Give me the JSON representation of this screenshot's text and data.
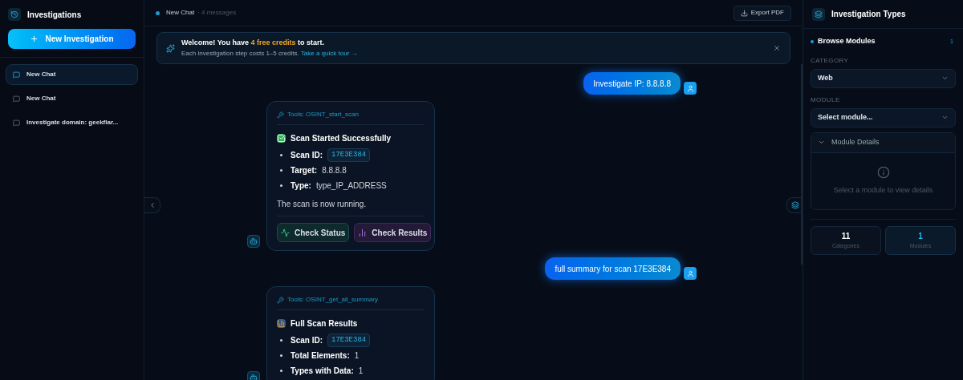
{
  "sidebar": {
    "title": "Investigations",
    "new_button": "New Investigation",
    "items": [
      {
        "label": "New Chat",
        "selected": true
      },
      {
        "label": "New Chat",
        "selected": false
      },
      {
        "label": "Investigate domain: geekflar...",
        "selected": false
      }
    ]
  },
  "chat": {
    "header": {
      "title": "New Chat",
      "meta": "· 4 messages"
    },
    "export_button": "Export PDF",
    "banner": {
      "before": "Welcome! You have",
      "highlight": "4 free credits",
      "after": "to start.",
      "subtitle": "Each investigation step costs 1–5 credits.",
      "link": "Take a quick tour →"
    },
    "messages": [
      {
        "kind": "user",
        "text": "Investigate IP: 8.8.8.8"
      },
      {
        "kind": "tool",
        "tool": "Tools: OSINT_start_scan",
        "heading": {
          "kind": "success",
          "text": "Scan Started Successfully"
        },
        "fields": [
          {
            "label": "Scan ID:",
            "value": "17E3E384",
            "kind": "code"
          },
          {
            "label": "Target:",
            "value": "8.8.8.8",
            "kind": "text"
          },
          {
            "label": "Type:",
            "value": "type_IP_ADDRESS",
            "kind": "text"
          }
        ],
        "note": "The scan is now running.",
        "actions": [
          {
            "label": "Check Status",
            "kind": "status"
          },
          {
            "label": "Check Results",
            "kind": "results"
          }
        ]
      },
      {
        "kind": "user",
        "text": "full summary for scan 17E3E384"
      },
      {
        "kind": "tool",
        "tool": "Tools: OSINT_get_all_summary",
        "heading": {
          "kind": "summary",
          "text": "Full Scan Results"
        },
        "fields": [
          {
            "label": "Scan ID:",
            "value": "17E3E384",
            "kind": "code"
          },
          {
            "label": "Total Elements:",
            "value": "1",
            "kind": "text"
          },
          {
            "label": "Types with Data:",
            "value": "1",
            "kind": "text"
          }
        ]
      }
    ]
  },
  "panel": {
    "title": "Investigation Types",
    "section": {
      "label": "Browse Modules",
      "count": "1"
    },
    "category": {
      "label": "CATEGORY",
      "value": "Web"
    },
    "module": {
      "label": "MODULE",
      "value": "Select module..."
    },
    "details": {
      "title": "Module Details",
      "expanded": true,
      "empty_text": "Select a module to view details"
    },
    "stats": [
      {
        "value": "11",
        "label": "Categories",
        "selected": false
      },
      {
        "value": "1",
        "label": "Modules",
        "selected": true
      }
    ]
  }
}
